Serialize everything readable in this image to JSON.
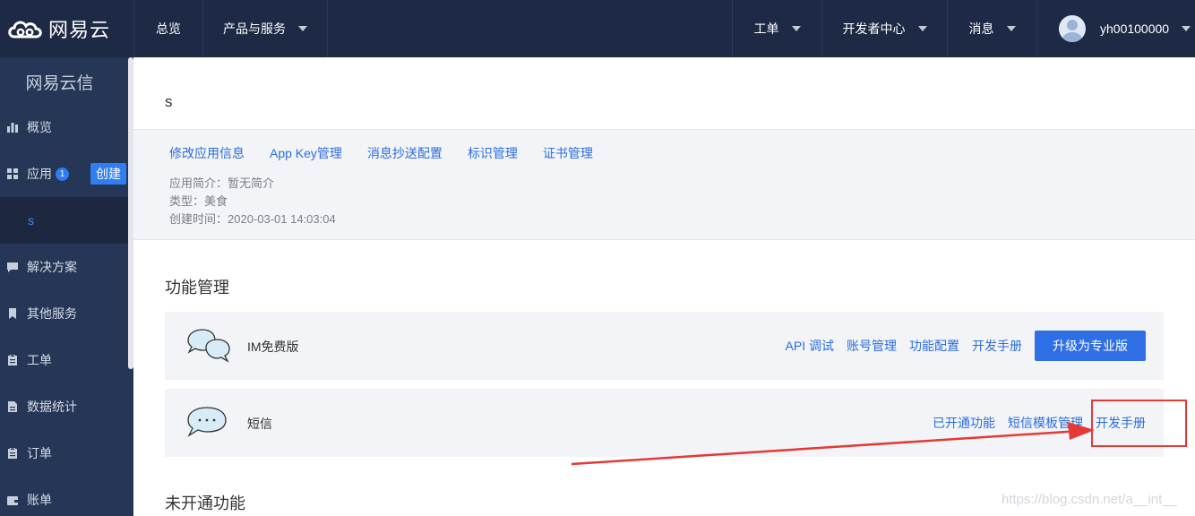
{
  "brand": {
    "logo_text": "网易云"
  },
  "topnav": {
    "overview": "总览",
    "products": "产品与服务",
    "tickets": "工单",
    "dev_center": "开发者中心",
    "messages": "消息",
    "username": "yh00100000"
  },
  "sidebar": {
    "title": "网易云信",
    "items": [
      {
        "label": "概览",
        "icon": "bar-chart-icon"
      },
      {
        "label": "应用",
        "icon": "grid-icon",
        "badge": "1"
      },
      {
        "label": "s"
      },
      {
        "label": "解决方案",
        "icon": "chat-icon"
      },
      {
        "label": "其他服务",
        "icon": "bookmark-icon"
      },
      {
        "label": "工单",
        "icon": "clipboard-icon"
      },
      {
        "label": "数据统计",
        "icon": "document-icon"
      },
      {
        "label": "订单",
        "icon": "clipboard-icon"
      },
      {
        "label": "账单",
        "icon": "wallet-icon"
      }
    ],
    "create_label": "创建"
  },
  "app": {
    "name": "s",
    "links": [
      "修改应用信息",
      "App Key管理",
      "消息抄送配置",
      "标识管理",
      "证书管理"
    ],
    "intro": "应用简介：暂无简介",
    "type": "类型：美食",
    "created": "创建时间：2020-03-01 14:03:04"
  },
  "functions": {
    "title": "功能管理",
    "rows": [
      {
        "name": "IM免费版",
        "icon": "chat-bubbles-icon",
        "links": [
          "API 调试",
          "账号管理",
          "功能配置",
          "开发手册"
        ],
        "button": "升级为专业版"
      },
      {
        "name": "短信",
        "icon": "speech-bubble-icon",
        "links": [
          "已开通功能",
          "短信模板管理",
          "开发手册"
        ]
      }
    ]
  },
  "unopened": {
    "title": "未开通功能"
  },
  "watermark": "https://blog.csdn.net/a__int__",
  "colors": {
    "topbar": "#1e2a45",
    "sidebar": "#263656",
    "link": "#2c6de0",
    "primary_button": "#2f6fe6",
    "annotation": "#e53935"
  }
}
